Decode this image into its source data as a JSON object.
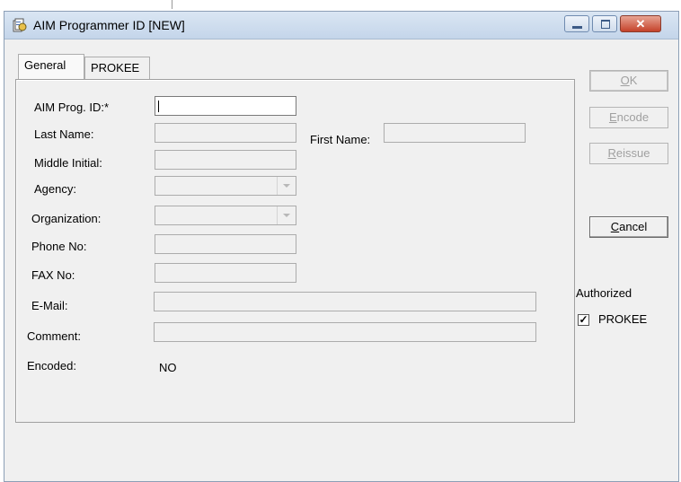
{
  "window": {
    "title": "AIM Programmer ID  [NEW]",
    "icon": "app-document-icon",
    "controls": {
      "minimize": "minimize-icon",
      "maximize": "maximize-icon",
      "close": "✕"
    }
  },
  "tabs": [
    {
      "label": "General",
      "active": true
    },
    {
      "label": "PROKEE",
      "active": false
    }
  ],
  "form": {
    "aim_prog_id": {
      "label": "AIM Prog. ID:*",
      "value": ""
    },
    "last_name": {
      "label": "Last Name:",
      "value": ""
    },
    "first_name": {
      "label": "First Name:",
      "value": ""
    },
    "middle_initial": {
      "label": "Middle Initial:",
      "value": ""
    },
    "agency": {
      "label": "Agency:",
      "value": ""
    },
    "organization": {
      "label": "Organization:",
      "value": ""
    },
    "phone": {
      "label": "Phone No:",
      "value": ""
    },
    "fax": {
      "label": "FAX No:",
      "value": ""
    },
    "email": {
      "label": "E-Mail:",
      "value": ""
    },
    "comment": {
      "label": "Comment:",
      "value": ""
    },
    "encoded": {
      "label": "Encoded:",
      "value": "NO"
    }
  },
  "buttons": {
    "ok": {
      "mnemonic": "O",
      "rest": "K",
      "enabled": false
    },
    "encode": {
      "mnemonic": "E",
      "rest": "ncode",
      "enabled": false
    },
    "reissue": {
      "mnemonic": "R",
      "rest": "eissue",
      "enabled": false
    },
    "cancel": {
      "mnemonic": "C",
      "rest": "ancel",
      "enabled": true
    }
  },
  "authorized": {
    "label": "Authorized",
    "prokee": {
      "label": "PROKEE",
      "checked": true,
      "mark": "✓"
    }
  }
}
